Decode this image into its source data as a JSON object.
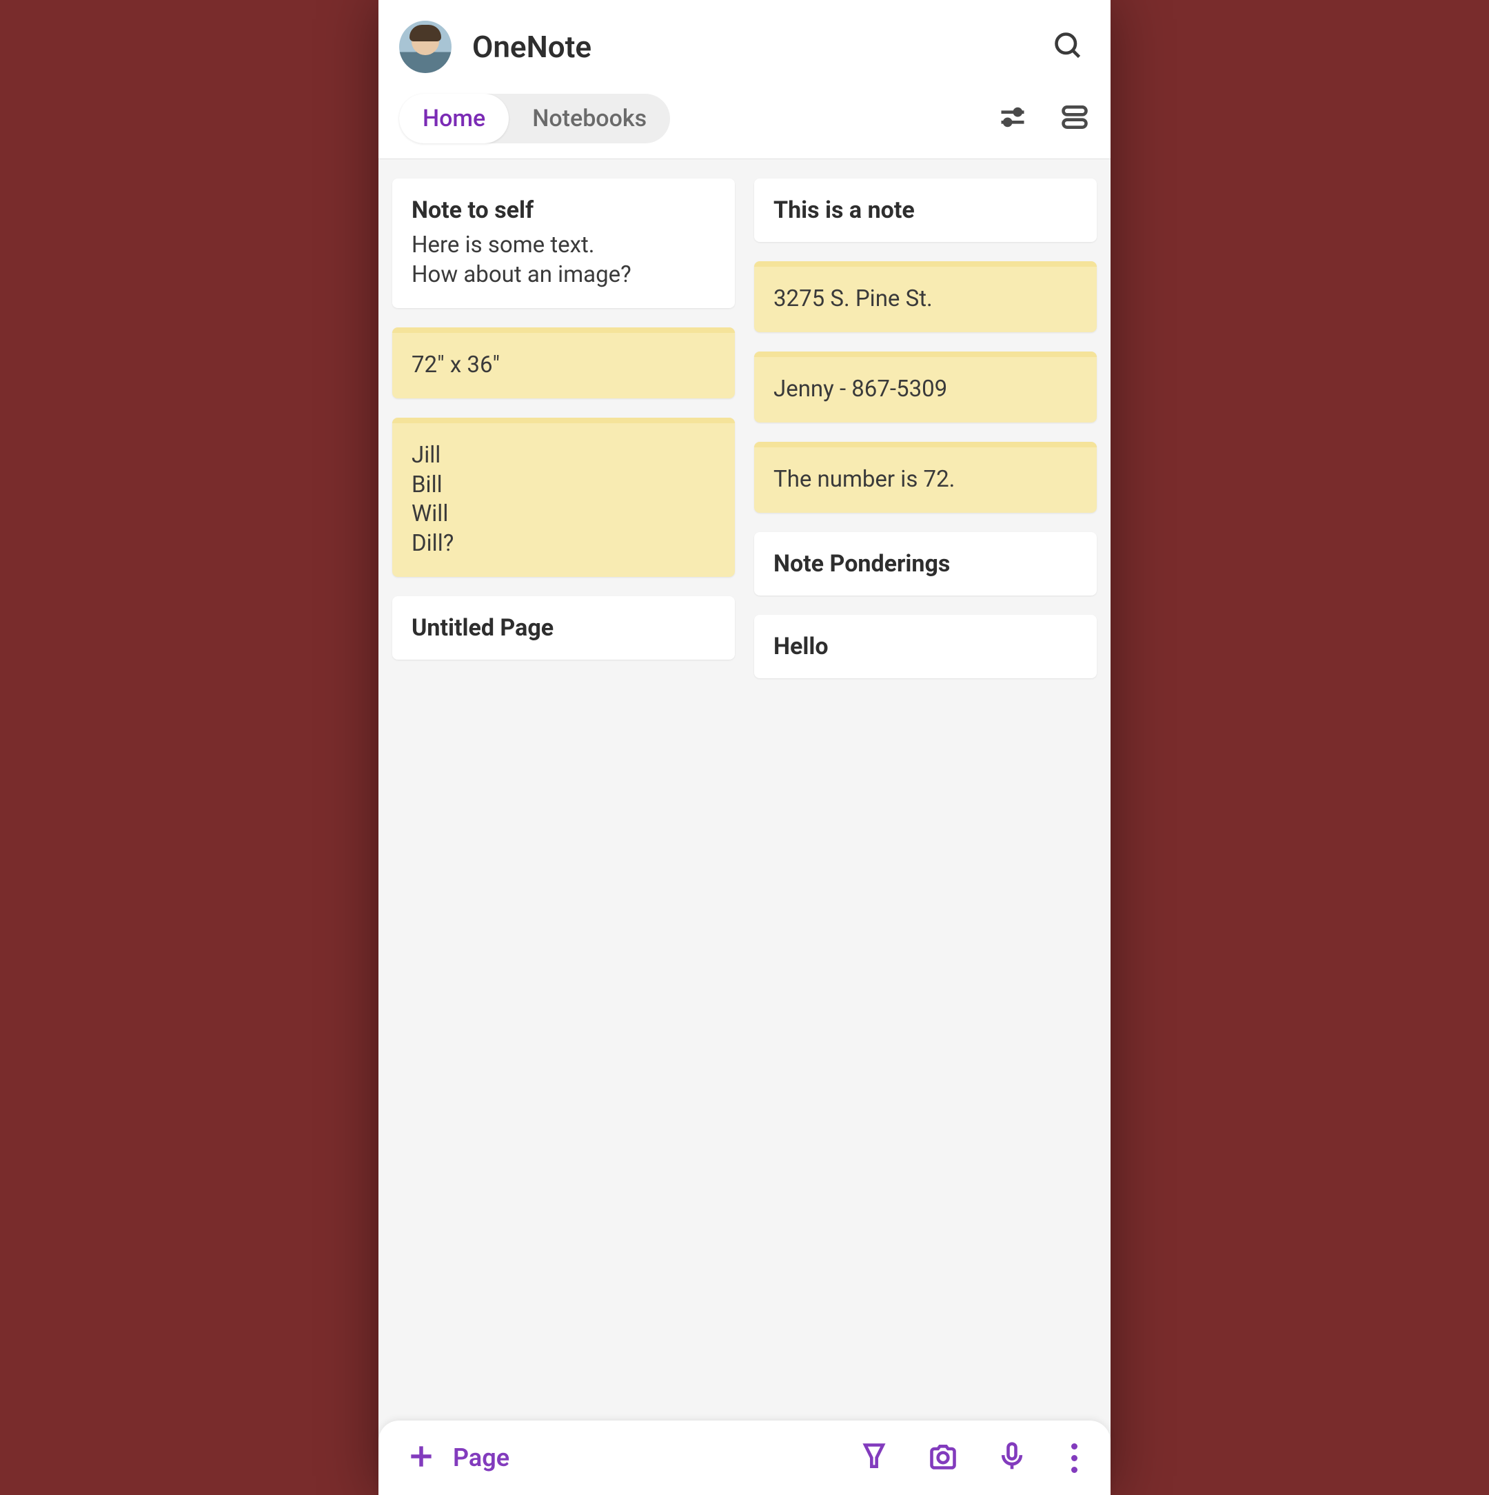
{
  "header": {
    "title": "OneNote"
  },
  "tabs": {
    "home": "Home",
    "notebooks": "Notebooks"
  },
  "notes": {
    "left": [
      {
        "title": "Note to self",
        "body": "Here is some text.\nHow about an image?",
        "sticky": false
      },
      {
        "body": "72\" x 36\"",
        "sticky": true
      },
      {
        "body": "Jill\nBill\nWill\nDill?",
        "sticky": true
      },
      {
        "title": "Untitled Page",
        "sticky": false
      }
    ],
    "right": [
      {
        "title": "This is a note",
        "sticky": false
      },
      {
        "body": "3275 S. Pine St.",
        "sticky": true
      },
      {
        "body": "Jenny - 867-5309",
        "sticky": true
      },
      {
        "body": "The number is 72.",
        "sticky": true
      },
      {
        "title": "Note Ponderings",
        "sticky": false
      },
      {
        "title": "Hello",
        "sticky": false
      }
    ]
  },
  "bottomBar": {
    "pageLabel": "Page"
  }
}
